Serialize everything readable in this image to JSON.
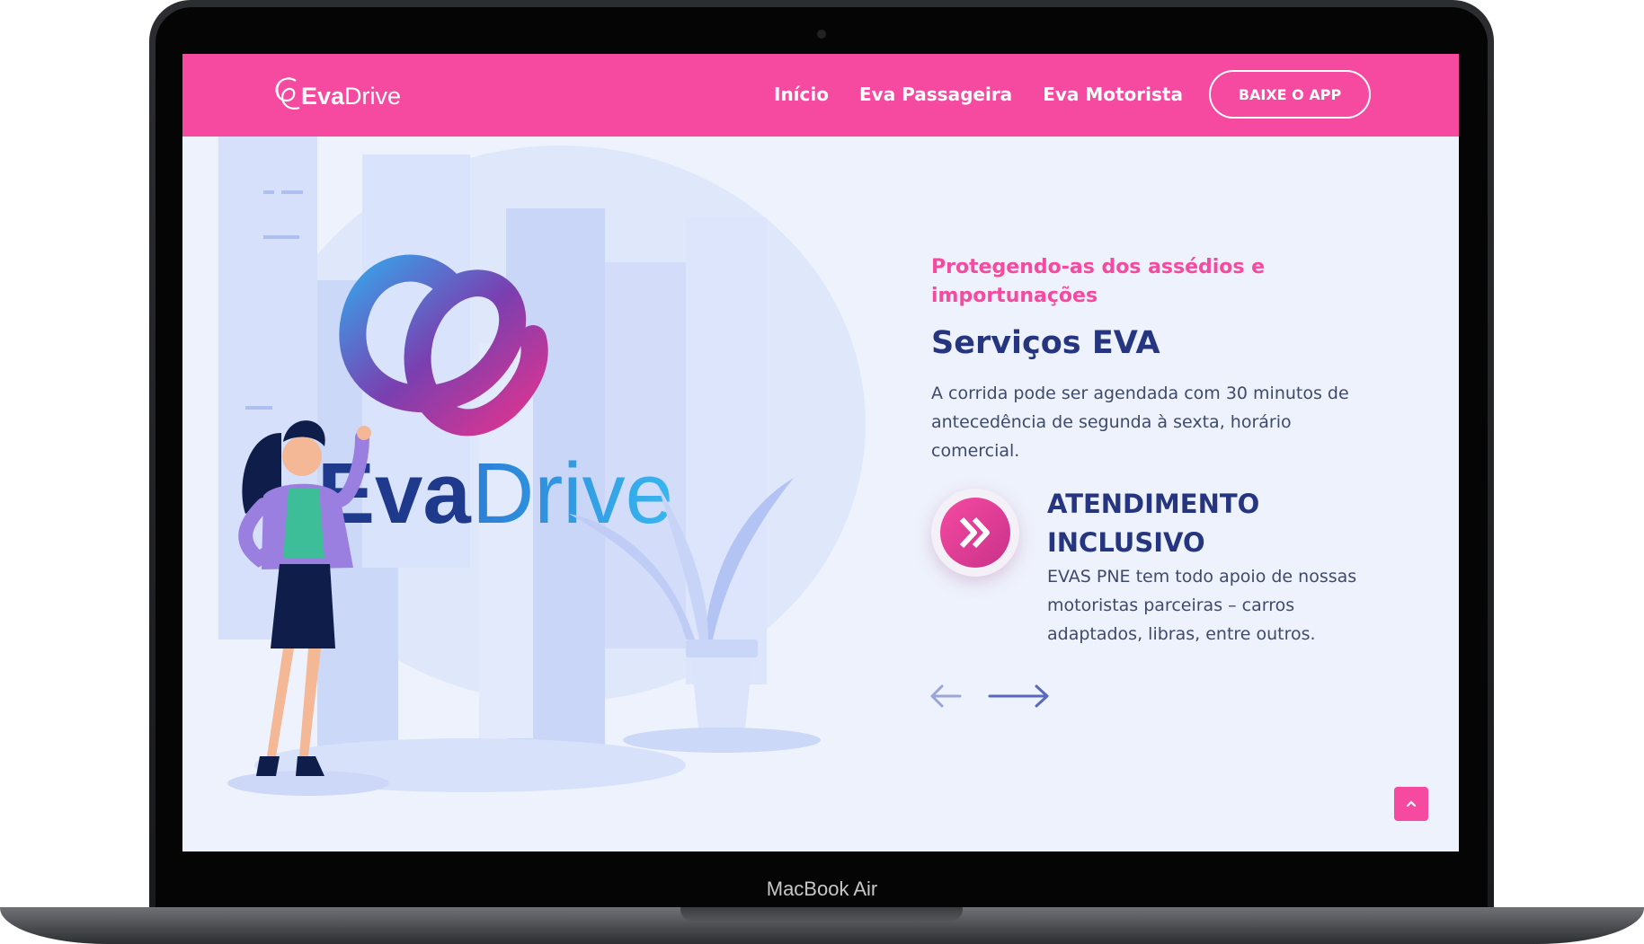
{
  "device": {
    "label": "MacBook Air"
  },
  "navbar": {
    "logo": {
      "bold": "Eva",
      "light": "Drive"
    },
    "links": [
      "Início",
      "Eva Passageira",
      "Eva Motorista"
    ],
    "cta": "BAIXE O APP",
    "color": "#f64aa1"
  },
  "hero": {
    "brand_logo": {
      "bold": "Eva",
      "light": "Drive"
    },
    "subtitle": "Protegendo-as dos assédios e importunações",
    "title": "Serviços EVA",
    "description": "A corrida pode ser agendada com 30 minutos de antecedência de segunda à sexta, horário comercial.",
    "feature": {
      "icon": "double-chevron-right-icon",
      "title": "ATENDIMENTO INCLUSIVO",
      "text": "EVAS PNE tem todo apoio de nossas motoristas parceiras – carros adaptados, libras, entre outros."
    }
  },
  "colors": {
    "accent": "#f64aa1",
    "heading": "#26357f",
    "body": "#3f4a6b",
    "background": "#eef2fc"
  }
}
